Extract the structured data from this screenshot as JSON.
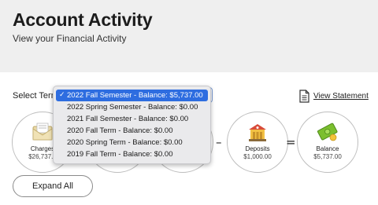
{
  "header": {
    "title": "Account Activity",
    "subtitle": "View your Financial Activity"
  },
  "term_select": {
    "label": "Select Term",
    "selected": "2022 Fall Semester - Balance: $5,737.00",
    "options": [
      "2022 Fall Semester - Balance: $5,737.00",
      "2022 Spring Semester - Balance: $0.00",
      "2021 Fall Semester - Balance: $0.00",
      "2020 Fall Term - Balance: $0.00",
      "2020 Spring Term - Balance: $0.00",
      "2019 Fall Term - Balance: $0.00"
    ]
  },
  "view_statement": {
    "label": "View Statement",
    "icon": "document-icon"
  },
  "summary": {
    "charges": {
      "label": "Charges",
      "amount": "$26,737.0",
      "icon": "envelope-icon"
    },
    "operator_minus_2": "–",
    "operator_equals": "=",
    "deposits": {
      "label": "Deposits",
      "amount": "$1,000.00",
      "icon": "bank-icon"
    },
    "balance": {
      "label": "Balance",
      "amount": "$5,737.00",
      "icon": "money-icon"
    }
  },
  "expand_all_label": "Expand All",
  "colors": {
    "header_bg": "#efefef",
    "selected_option_bg": "#2e6de0",
    "money_green": "#7bbf2e",
    "bank_red": "#d84b3a"
  }
}
